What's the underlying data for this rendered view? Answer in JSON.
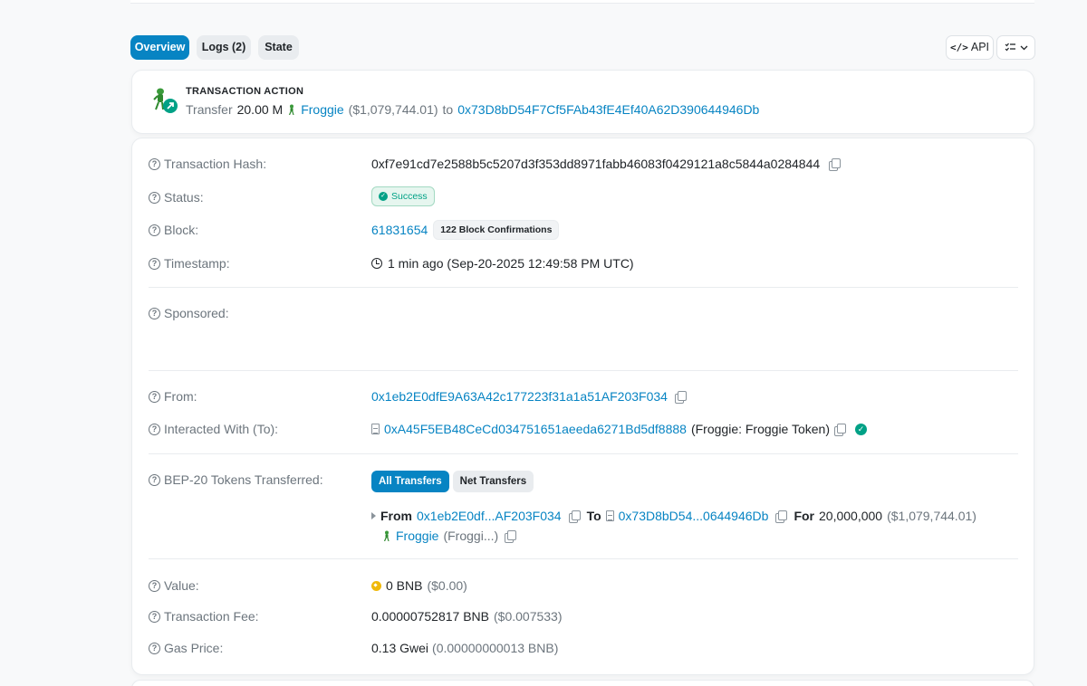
{
  "tabs": {
    "overview": "Overview",
    "logs": "Logs (2)",
    "state": "State",
    "api_code": "</>",
    "api": "API"
  },
  "action": {
    "title": "TRANSACTION ACTION",
    "verb": "Transfer",
    "amount": "20.00 M",
    "token": "Froggie",
    "usd": "($1,079,744.01)",
    "to_word": "to",
    "to_address": "0x73D8bD54F7Cf5FAb43fE4Ef40A62D390644946Db"
  },
  "details": {
    "hash_label": "Transaction Hash:",
    "hash": "0xf7e91cd7e2588b5c5207d3f353dd8971fabb46083f0429121a8c5844a0284844",
    "status_label": "Status:",
    "status": "Success",
    "block_label": "Block:",
    "block": "61831654",
    "confirmations": "122 Block Confirmations",
    "timestamp_label": "Timestamp:",
    "timestamp": "1 min ago (Sep-20-2025 12:49:58 PM UTC)",
    "sponsored_label": "Sponsored:",
    "from_label": "From:",
    "from": "0x1eb2E0dfE9A63A42c177223f31a1a51AF203F034",
    "to_label": "Interacted With (To):",
    "to_address": "0xA45F5EB48CeCd034751651aeeda6271Bd5df8888",
    "to_name": "(Froggie: Froggie Token)",
    "tokens_label": "BEP-20 Tokens Transferred:",
    "all_transfers": "All Transfers",
    "net_transfers": "Net Transfers",
    "transfer": {
      "from_word": "From",
      "from": "0x1eb2E0df...AF203F034",
      "to_word": "To",
      "to": "0x73D8bD54...0644946Db",
      "for_word": "For",
      "amount": "20,000,000",
      "usd": "($1,079,744.01)",
      "token": "Froggie",
      "token_symbol": "(Froggi...)"
    },
    "value_label": "Value:",
    "value": "0 BNB",
    "value_usd": "($0.00)",
    "fee_label": "Transaction Fee:",
    "fee": "0.00000752817 BNB",
    "fee_usd": "($0.007533)",
    "gas_label": "Gas Price:",
    "gas": "0.13 Gwei",
    "gas_detail": "(0.00000000013 BNB)"
  },
  "colors": {
    "link": "#0784c3",
    "success": "#00a186",
    "muted": "#6c757d"
  }
}
